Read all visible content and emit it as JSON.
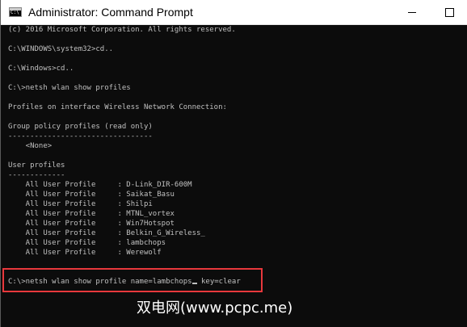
{
  "window": {
    "title": "Administrator: Command Prompt",
    "icon_name": "cmd-icon",
    "minimize_icon": "minimize-icon",
    "maximize_icon": "maximize-icon"
  },
  "console": {
    "lines": [
      "(c) 2016 Microsoft Corporation. All rights reserved.",
      "",
      "C:\\WINDOWS\\system32>cd..",
      "",
      "C:\\Windows>cd..",
      "",
      "C:\\>netsh wlan show profiles",
      "",
      "Profiles on interface Wireless Network Connection:",
      "",
      "Group policy profiles (read only)",
      "---------------------------------",
      "    <None>",
      "",
      "User profiles",
      "-------------",
      "    All User Profile     : D-Link_DIR-600M",
      "    All User Profile     : Saikat_Basu",
      "    All User Profile     : Shilpi",
      "    All User Profile     : MTNL_vortex",
      "    All User Profile     : Win7Hotspot",
      "    All User Profile     : Belkin_G_Wireless_",
      "    All User Profile     : lambchops",
      "    All User Profile     : Werewolf",
      "",
      ""
    ],
    "command_before_cursor": "C:\\>netsh wlan show profile name=lambchops",
    "command_after_cursor": " key=clear"
  },
  "colors": {
    "console_background": "#0c0c0c",
    "console_text": "#c0c0c0",
    "highlight_border": "#e8383c",
    "titlebar_background": "#ffffff"
  },
  "watermark": "双电网(www.pcpc.me)"
}
